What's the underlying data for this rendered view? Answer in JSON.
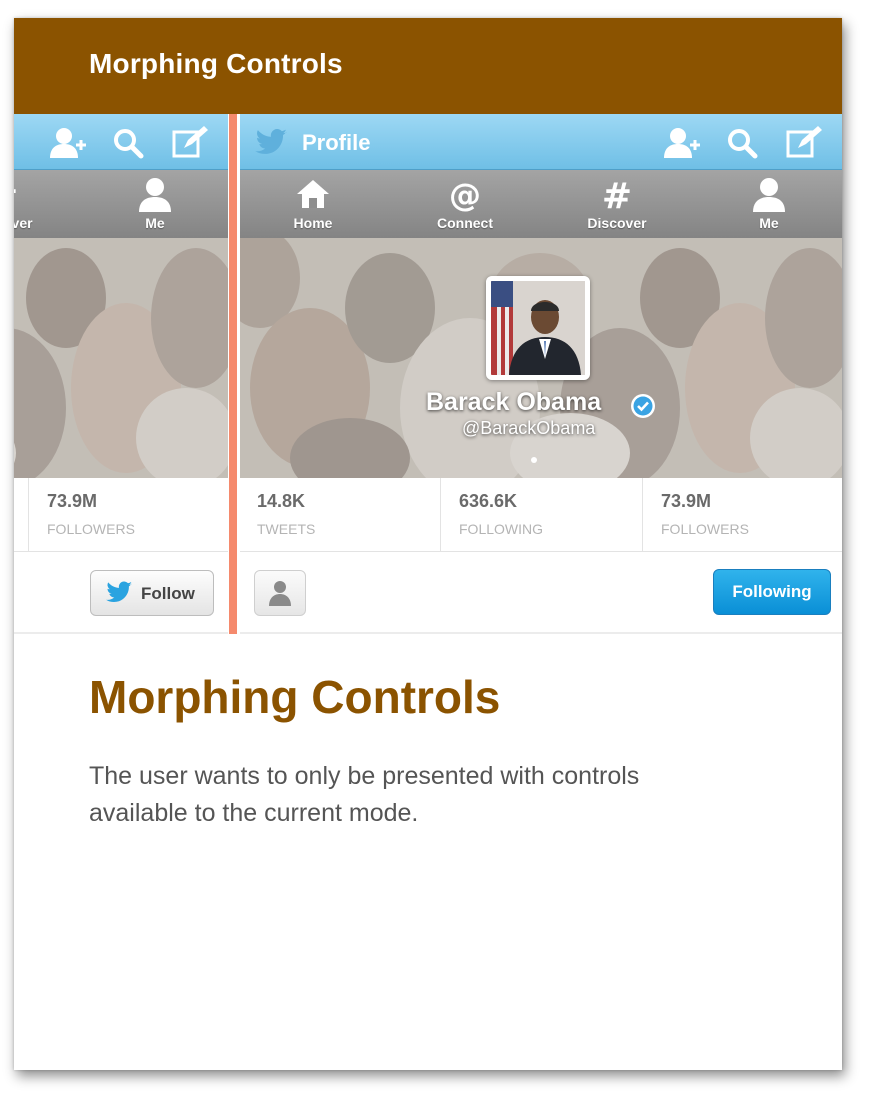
{
  "banner": {
    "title": "Morphing Controls"
  },
  "header": {
    "title": "Profile"
  },
  "nav": [
    {
      "label": "Home",
      "icon": "home-icon"
    },
    {
      "label": "Connect",
      "icon": "at-icon"
    },
    {
      "label": "Discover",
      "icon": "hash-icon"
    },
    {
      "label": "Me",
      "icon": "person-icon"
    }
  ],
  "profile": {
    "name": "Barack Obama",
    "handle": "@BarackObama",
    "verified": true
  },
  "stats": [
    {
      "value": "14.8K",
      "label": "TWEETS"
    },
    {
      "value": "636.6K",
      "label": "FOLLOWING"
    },
    {
      "value": "73.9M",
      "label": "FOLLOWERS"
    }
  ],
  "buttons": {
    "follow": "Follow",
    "following": "Following"
  },
  "content": {
    "heading": "Morphing Controls",
    "description": "The user wants to only be presented with controls available to the current mode."
  },
  "colors": {
    "brand_brown": "#8b5300",
    "divider_salmon": "#f58a6d",
    "twitter_blue": "#6fbfe6",
    "following_blue": "#0a8fd6"
  }
}
